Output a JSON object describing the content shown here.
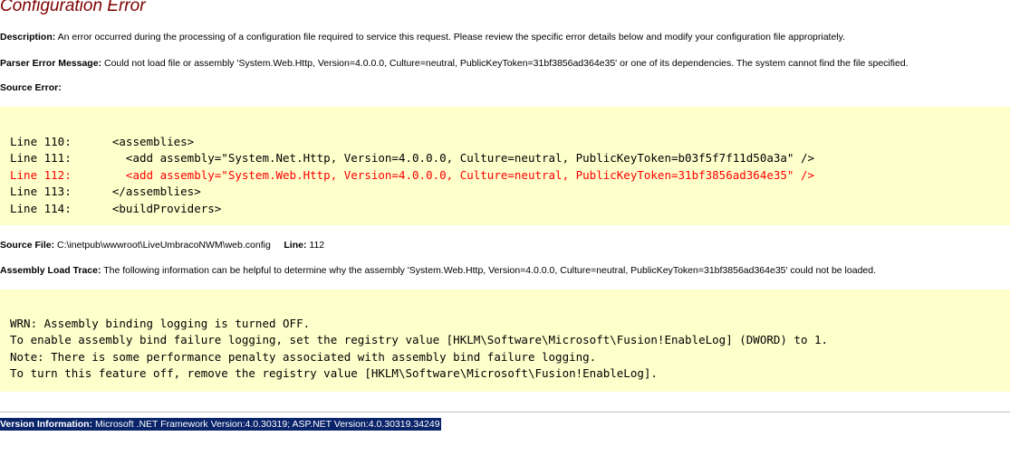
{
  "title": "Configuration Error",
  "description": {
    "label": "Description:",
    "text": "An error occurred during the processing of a configuration file required to service this request. Please review the specific error details below and modify your configuration file appropriately."
  },
  "parser_error": {
    "label": "Parser Error Message:",
    "text": "Could not load file or assembly 'System.Web.Http, Version=4.0.0.0, Culture=neutral, PublicKeyToken=31bf3856ad364e35' or one of its dependencies. The system cannot find the file specified."
  },
  "source_error": {
    "label": "Source Error:",
    "lines": [
      "Line 110:      <assemblies>",
      "Line 111:        <add assembly=\"System.Net.Http, Version=4.0.0.0, Culture=neutral, PublicKeyToken=b03f5f7f11d50a3a\" />",
      "Line 112:        <add assembly=\"System.Web.Http, Version=4.0.0.0, Culture=neutral, PublicKeyToken=31bf3856ad364e35\" />",
      "Line 113:      </assemblies>",
      "Line 114:      <buildProviders>"
    ],
    "error_line_color": "#ff0000"
  },
  "source_file": {
    "label": "Source File:",
    "path": "C:\\inetpub\\wwwroot\\LiveUmbracoNWM\\web.config",
    "line_label": "Line:",
    "line_number": "112"
  },
  "assembly_trace": {
    "label": "Assembly Load Trace:",
    "text": "The following information can be helpful to determine why the assembly 'System.Web.Http, Version=4.0.0.0, Culture=neutral, PublicKeyToken=31bf3856ad364e35' could not be loaded.",
    "lines": [
      "WRN: Assembly binding logging is turned OFF.",
      "To enable assembly bind failure logging, set the registry value [HKLM\\Software\\Microsoft\\Fusion!EnableLog] (DWORD) to 1.",
      "Note: There is some performance penalty associated with assembly bind failure logging.",
      "To turn this feature off, remove the registry value [HKLM\\Software\\Microsoft\\Fusion!EnableLog]."
    ]
  },
  "version": {
    "label": "Version Information:",
    "text": "Microsoft .NET Framework Version:4.0.30319; ASP.NET Version:4.0.30319.34249"
  },
  "colors": {
    "title": "#800000",
    "code_background": "#ffffcc",
    "selection_background": "#0a246a"
  }
}
